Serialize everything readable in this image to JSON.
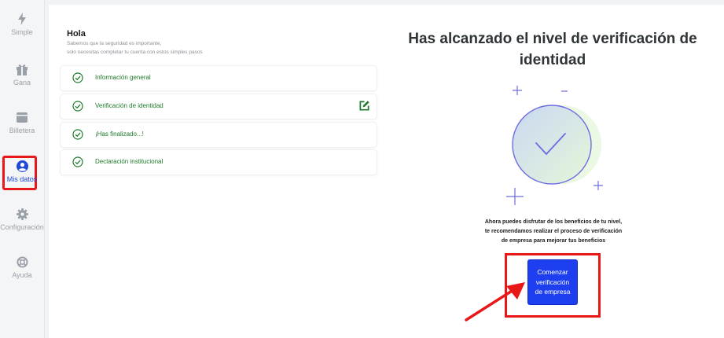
{
  "sidebar": {
    "items": [
      {
        "label": "Simple",
        "icon": "bolt-icon",
        "active": false
      },
      {
        "label": "Gana",
        "icon": "gift-icon",
        "active": false
      },
      {
        "label": "Billetera",
        "icon": "wallet-icon",
        "active": false
      },
      {
        "label": "Mis datos",
        "icon": "user-circle-icon",
        "active": true
      },
      {
        "label": "Configuración",
        "icon": "gear-icon",
        "active": false
      },
      {
        "label": "Ayuda",
        "icon": "lifebuoy-icon",
        "active": false
      }
    ]
  },
  "panel": {
    "greeting": "Hola",
    "subtitle_line1": "Sabemos que la seguridad es importante,",
    "subtitle_line2": "solo necesitas completar tu cuenta con estos simples pasos",
    "steps": [
      {
        "label": "Información general",
        "status": "completed"
      },
      {
        "label": "Verificación de identidad",
        "status": "completed",
        "editable": true
      },
      {
        "label": "¡Has finalizado...!",
        "status": "completed"
      },
      {
        "label": "Declaración institucional",
        "status": "completed"
      }
    ]
  },
  "result": {
    "heading": "Has alcanzado el nivel de verificación de identidad",
    "description": "Ahora puedes disfrutar de los beneficios de tu nivel, te recomendamos realizar el proceso de verificación de empresa para mejorar tus beneficios",
    "cta_label": "Comenzar verificación de empresa"
  },
  "colors": {
    "accent": "#1e3ff0",
    "success": "#1e7a2a",
    "highlight": "#e81818",
    "inactive": "#9aa0a8"
  }
}
